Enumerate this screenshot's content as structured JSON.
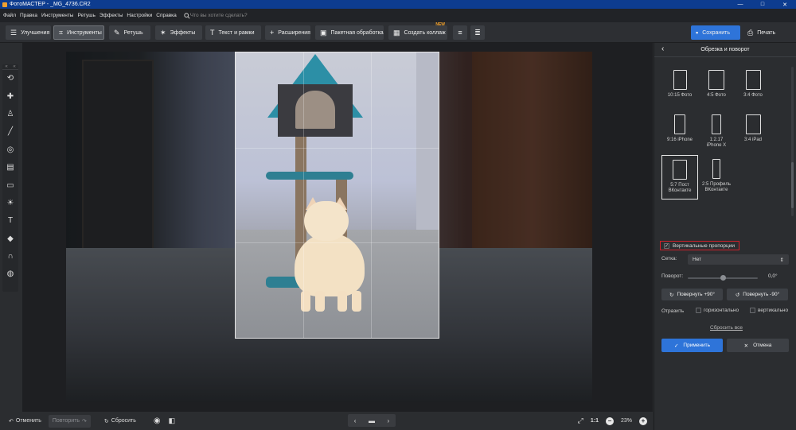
{
  "window": {
    "title": "ФотоМАСТЕР - _MG_4736.CR2",
    "min_glyph": "—",
    "max_glyph": "□",
    "close_glyph": "✕"
  },
  "menu": {
    "items": [
      "Файл",
      "Правка",
      "Инструменты",
      "Ретушь",
      "Эффекты",
      "Настройки",
      "Справка"
    ],
    "search_placeholder": "Что вы хотите сделать?"
  },
  "toolbar": {
    "tabs": [
      {
        "label": "Улучшения",
        "icon": "sliders-icon"
      },
      {
        "label": "Инструменты",
        "icon": "crop-icon",
        "active": true
      },
      {
        "label": "Ретушь",
        "icon": "brush-icon"
      },
      {
        "label": "Эффекты",
        "icon": "magic-wand-icon"
      },
      {
        "label": "Текст и рамки",
        "icon": "text-icon"
      },
      {
        "label": "Расширения",
        "icon": "plus-icon"
      }
    ],
    "batch_label": "Пакетная обработка",
    "collage_label": "Создать коллаж",
    "collage_badge": "NEW",
    "save_label": "Сохранить",
    "print_label": "Печать"
  },
  "bottombar": {
    "undo_label": "Отменить",
    "redo_label": "Повторить",
    "reset_label": "Сбросить",
    "ratio_label": "1:1",
    "zoom_label": "23%"
  },
  "panel": {
    "title": "Обрезка и поворот",
    "presets": [
      {
        "label": "10:15 Фото",
        "ratio": 0.667
      },
      {
        "label": "4:5 Фото",
        "ratio": 0.8
      },
      {
        "label": "3:4 Фото",
        "ratio": 0.75
      },
      {
        "label": "9:16 iPhone",
        "ratio": 0.5625
      },
      {
        "label": "1:2.17\niPhone X",
        "ratio": 0.46
      },
      {
        "label": "3:4 iPad",
        "ratio": 0.75
      },
      {
        "label": "5:7 Пост\nВКонтакте",
        "ratio": 0.714,
        "selected": true
      },
      {
        "label": "2:5 Профиль\nВКонтакте",
        "ratio": 0.4
      }
    ],
    "vertical_label": "Вертикальные пропорции",
    "vertical_checked": true,
    "grid_label": "Сетка:",
    "grid_value": "Нет",
    "rotation_label": "Поворот:",
    "rotation_value": "0,0°",
    "rotation_fraction": 0.5,
    "rotate_plus_label": "Повернуть +90°",
    "rotate_minus_label": "Повернуть -90°",
    "flip_label": "Отразить",
    "flip_h_label": "горизонтально",
    "flip_v_label": "вертикально",
    "reset_all_label": "Сбросить все",
    "apply_label": "Применить",
    "cancel_label": "Отмена"
  },
  "colors": {
    "accent": "#2e74d9",
    "titlebar": "#0d3c8f",
    "highlight_border": "#d0202a",
    "new_badge": "#f3a12a"
  }
}
